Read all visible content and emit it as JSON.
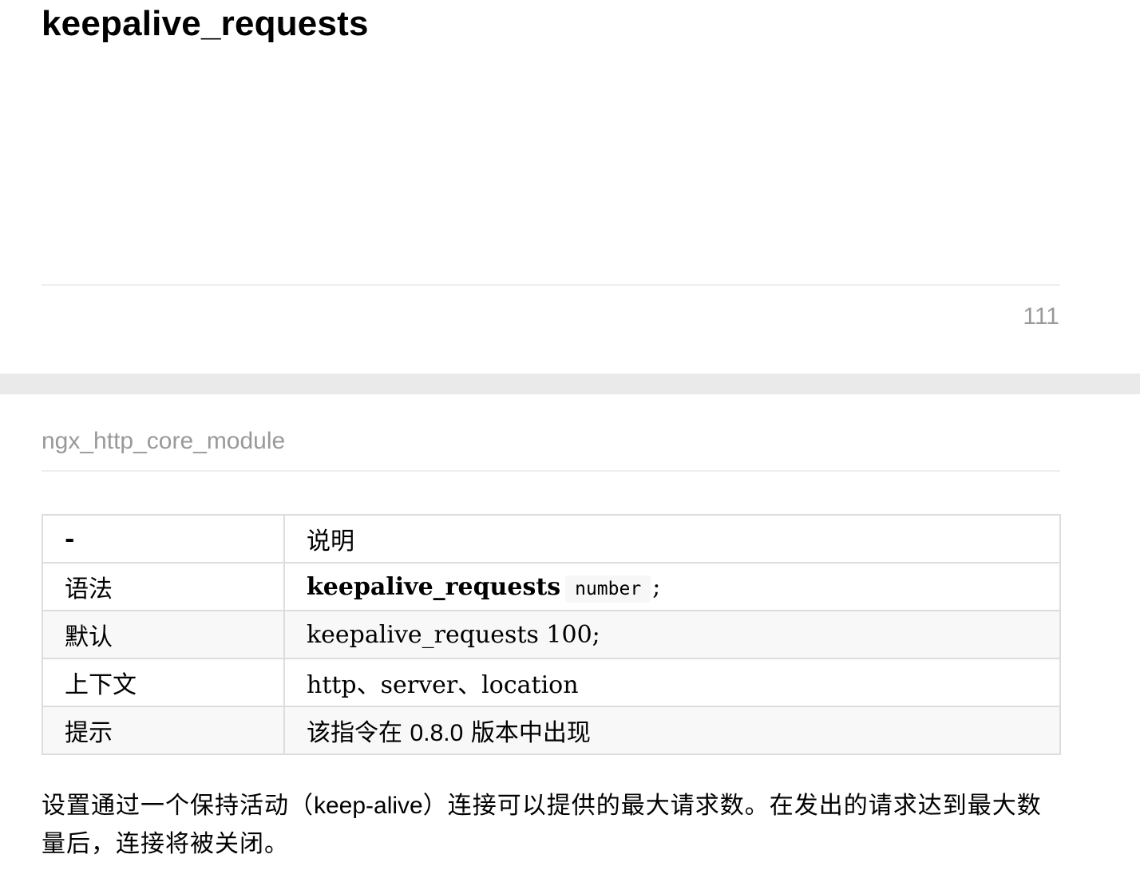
{
  "page_top": {
    "heading": "keepalive_requests",
    "page_number": "111"
  },
  "page_bottom": {
    "running_header": "ngx_http_core_module",
    "table": {
      "header": {
        "key": "-",
        "value": "说明"
      },
      "rows": [
        {
          "key": "语法",
          "value_directive": "keepalive_requests",
          "value_param": "number",
          "value_suffix": ";"
        },
        {
          "key": "默认",
          "value": "keepalive_requests 100;"
        },
        {
          "key": "上下文",
          "value": "http、server、location"
        },
        {
          "key": "提示",
          "value_prefix": "该指令在 ",
          "value_version": "0.8.0",
          "value_suffix": " 版本中出现"
        }
      ]
    },
    "paragraph": {
      "part1": "设置通过一个保持活动（",
      "part2": "keep-alive",
      "part3": "）连接可以提供的最大请求数。在发出的请求达到最大数量后，连接将被关闭。"
    }
  }
}
